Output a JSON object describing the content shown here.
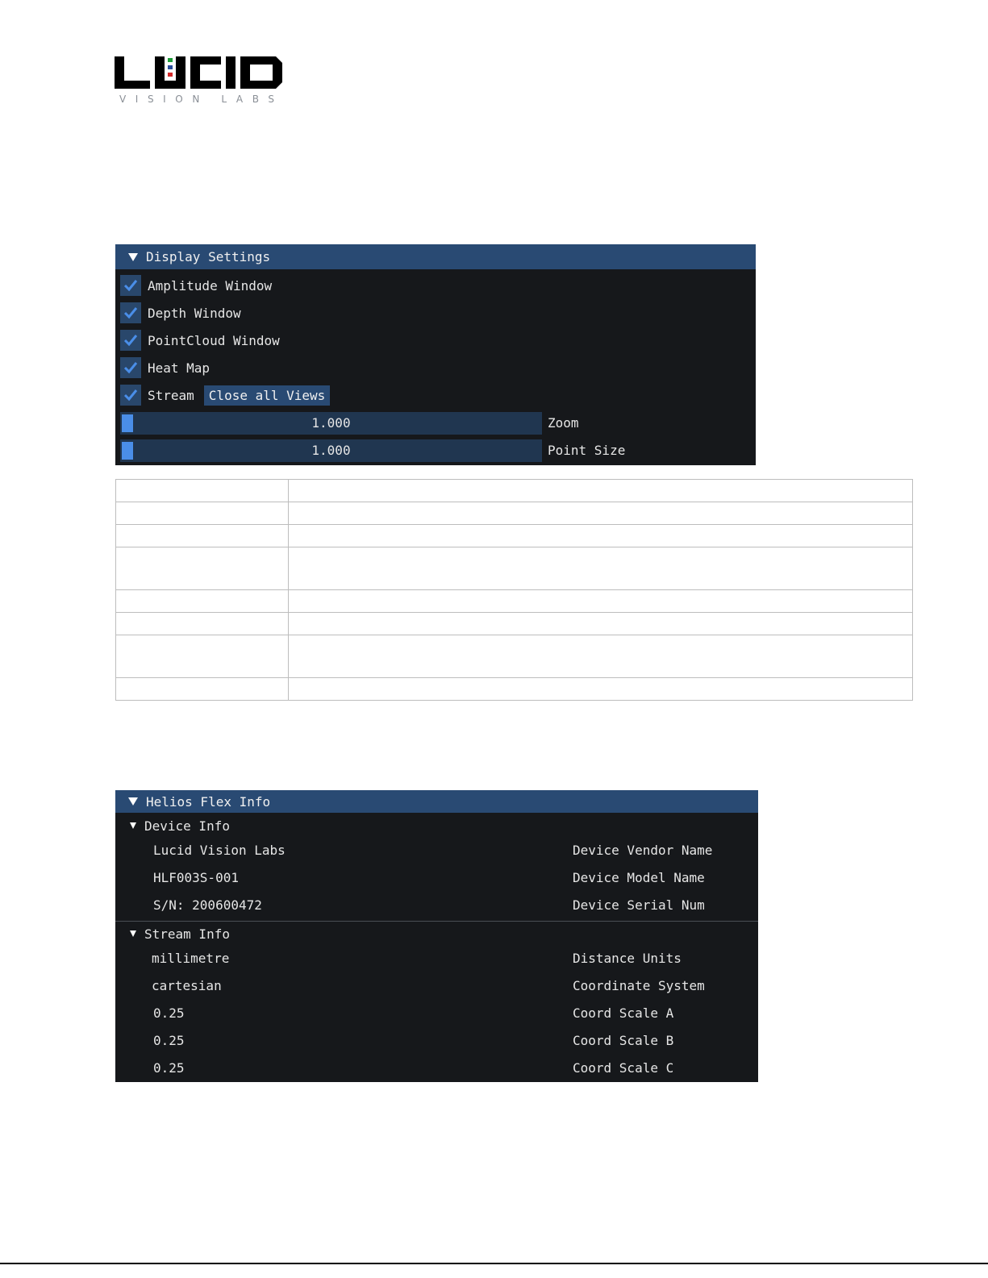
{
  "logo": {
    "brand": "LUCID",
    "subtitle": "VISION LABS",
    "colors": {
      "mark": "#000000",
      "green": "#1f9e3a",
      "blue": "#2a4d9b",
      "red": "#d22a2a"
    }
  },
  "display_settings": {
    "header": "Display Settings",
    "checkboxes": [
      {
        "label": "Amplitude Window",
        "checked": true
      },
      {
        "label": "Depth Window",
        "checked": true
      },
      {
        "label": "PointCloud Window",
        "checked": true
      },
      {
        "label": "Heat Map",
        "checked": true
      },
      {
        "label": "Stream",
        "checked": true
      }
    ],
    "close_button": "Close all Views",
    "sliders": [
      {
        "value": "1.000",
        "label": "Zoom"
      },
      {
        "value": "1.000",
        "label": "Point Size"
      }
    ]
  },
  "table": {
    "rows": [
      {
        "key": "",
        "value": "",
        "tall": false
      },
      {
        "key": "",
        "value": "",
        "tall": false
      },
      {
        "key": "",
        "value": "",
        "tall": false
      },
      {
        "key": "",
        "value": "",
        "tall": true
      },
      {
        "key": "",
        "value": "",
        "tall": false
      },
      {
        "key": "",
        "value": "",
        "tall": false
      },
      {
        "key": "",
        "value": "",
        "tall": true
      },
      {
        "key": "",
        "value": "",
        "tall": false
      }
    ]
  },
  "helios_info": {
    "header": "Helios Flex Info",
    "device_info": {
      "title": "Device Info",
      "rows": [
        {
          "value": "Lucid Vision Labs",
          "label": "Device Vendor Name"
        },
        {
          "value": "HLF003S-001",
          "label": "Device Model Name"
        },
        {
          "value": "S/N:  200600472",
          "label": "Device Serial Num"
        }
      ]
    },
    "stream_info": {
      "title": "Stream Info",
      "rows": [
        {
          "value": "millimetre",
          "label": "Distance Units"
        },
        {
          "value": "cartesian",
          "label": "Coordinate System"
        },
        {
          "value": "0.25",
          "label": "Coord Scale A"
        },
        {
          "value": "0.25",
          "label": "Coord Scale B"
        },
        {
          "value": "0.25",
          "label": "Coord Scale C"
        }
      ]
    }
  },
  "theme": {
    "accent": "#4a8ee8",
    "header_bg": "#294a73",
    "panel_bg": "#16181b"
  }
}
